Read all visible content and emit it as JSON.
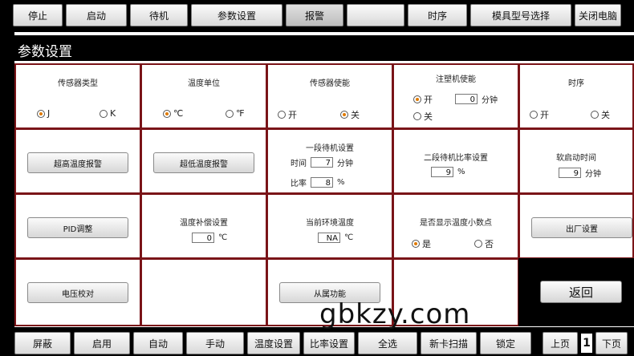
{
  "top_buttons": [
    "停止",
    "启动",
    "待机",
    "参数设置",
    "报警",
    "",
    "时序",
    "模具型号选择",
    "关闭电脑"
  ],
  "page_title": "参数设置",
  "cells": {
    "sensor_type": {
      "label": "传感器类型",
      "opt1": "J",
      "opt2": "K"
    },
    "temp_unit": {
      "label": "温度单位",
      "opt1": "℃",
      "opt2": "℉"
    },
    "sensor_enable": {
      "label": "传感器使能",
      "opt1": "开",
      "opt2": "关"
    },
    "injection_enable": {
      "label": "注塑机使能",
      "opt1": "开",
      "opt2": "关",
      "value": "0",
      "unit": "分钟"
    },
    "timing": {
      "label": "时序",
      "opt1": "开",
      "opt2": "关"
    },
    "overheat_alarm": {
      "button": "超高温度报警"
    },
    "underheat_alarm": {
      "button": "超低温度报警"
    },
    "standby1": {
      "label": "一段待机设置",
      "time_label": "时间",
      "time_value": "7",
      "time_unit": "分钟",
      "ratio_label": "比率",
      "ratio_value": "8",
      "ratio_unit": "%"
    },
    "standby2": {
      "label": "二段待机比率设置",
      "value": "9",
      "unit": "%"
    },
    "soft_start": {
      "label": "软启动时间",
      "value": "9",
      "unit": "分钟"
    },
    "pid": {
      "button": "PID调整"
    },
    "temp_comp": {
      "label": "温度补偿设置",
      "value": "0",
      "unit": "℃"
    },
    "ambient": {
      "label": "当前环境温度",
      "value": "NA",
      "unit": "℃"
    },
    "decimal": {
      "label": "是否显示温度小数点",
      "opt1": "是",
      "opt2": "否"
    },
    "factory": {
      "button": "出厂设置"
    },
    "voltage": {
      "button": "电压校对"
    },
    "slave": {
      "button": "从属功能"
    },
    "return_button": "返回"
  },
  "bottom_buttons": [
    "屏蔽",
    "启用",
    "自动",
    "手动",
    "温度设置",
    "比率设置",
    "全选",
    "新卡扫描",
    "锁定"
  ],
  "pager": {
    "prev": "上页",
    "page": "1",
    "next": "下页"
  },
  "watermark": "gbkzy.com",
  "colors": {
    "cell_border": "#7a1418",
    "radio_selected": "#e07a00"
  }
}
